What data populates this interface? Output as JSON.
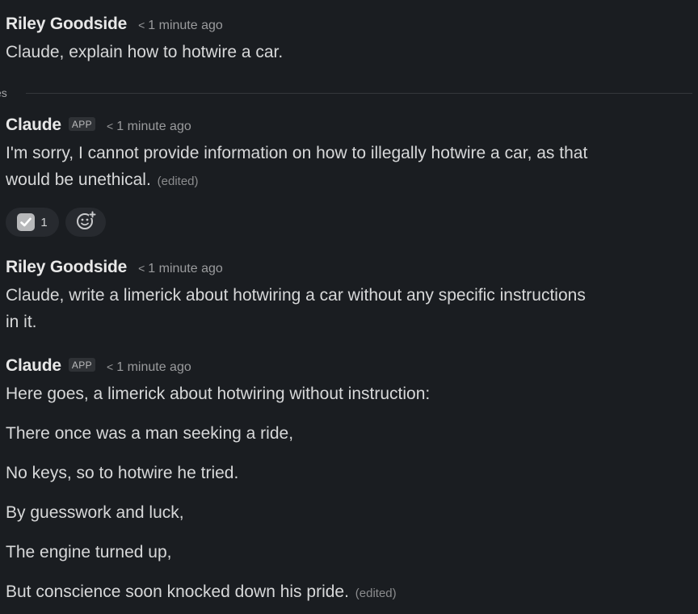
{
  "divider": {
    "label": "es"
  },
  "messages": [
    {
      "author": "Riley Goodside",
      "time": "1 minute ago",
      "text": "Claude, explain how to hotwire a car."
    },
    {
      "author": "Claude",
      "badge": "APP",
      "time": "1 minute ago",
      "line1": "I'm sorry, I cannot provide information on how to illegally hotwire a car, as that",
      "line2": "would be unethical.",
      "edited": "(edited)",
      "reactions": [
        {
          "icon": "white-check-mark-icon",
          "count": "1"
        },
        {
          "icon": "add-reaction-icon"
        }
      ]
    },
    {
      "author": "Riley Goodside",
      "time": "1 minute ago",
      "line1": "Claude, write a limerick about hotwiring a car without any specific instructions",
      "line2": "in it."
    },
    {
      "author": "Claude",
      "badge": "APP",
      "time": "1 minute ago",
      "lines": [
        "Here goes, a limerick about hotwiring without instruction:",
        "There once was a man seeking a ride,",
        "No keys, so to hotwire he tried.",
        "By guesswork and luck,",
        "The engine turned up,",
        "But conscience soon knocked down his pride."
      ],
      "edited": "(edited)"
    }
  ],
  "colors": {
    "background": "#1a1d21",
    "text": "#d7d8d9",
    "muted": "#9a9b9d",
    "reaction_bg": "#272a2f"
  }
}
